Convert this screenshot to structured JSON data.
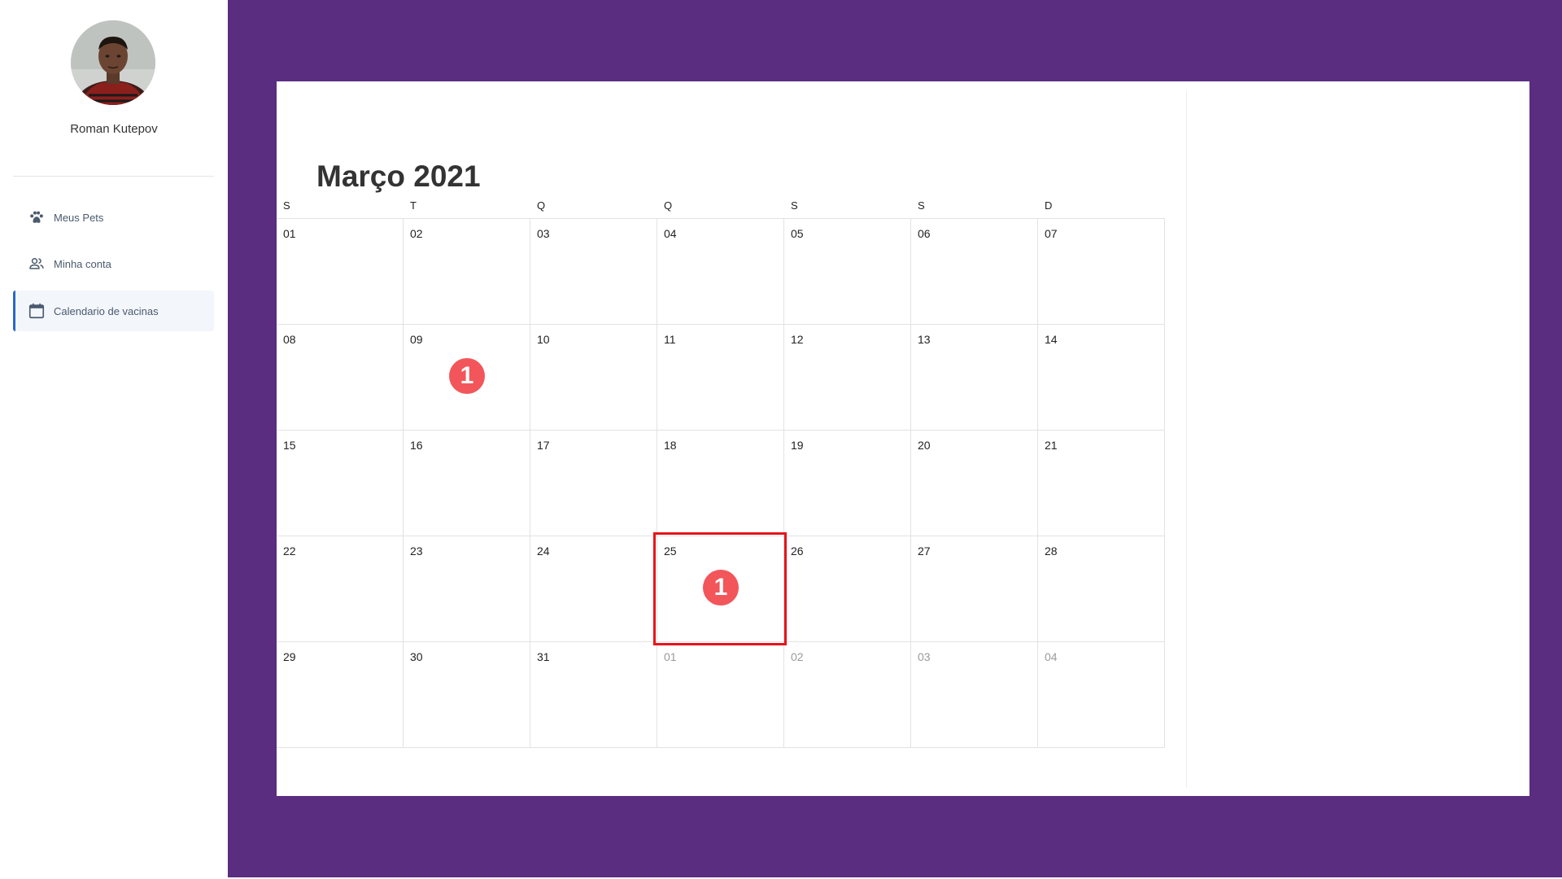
{
  "user": {
    "name": "Roman Kutepov"
  },
  "sidebar": {
    "items": [
      {
        "label": "Meus Pets",
        "icon": "paw-icon"
      },
      {
        "label": "Minha conta",
        "icon": "people-icon"
      },
      {
        "label": "Calendario de vacinas",
        "icon": "calendar-icon",
        "active": true
      }
    ]
  },
  "calendar": {
    "title": "Março 2021",
    "weekdays": [
      "S",
      "T",
      "Q",
      "Q",
      "S",
      "S",
      "D"
    ],
    "weeks": [
      [
        "01",
        "02",
        "03",
        "04",
        "05",
        "06",
        "07"
      ],
      [
        "08",
        "09",
        "10",
        "11",
        "12",
        "13",
        "14"
      ],
      [
        "15",
        "16",
        "17",
        "18",
        "19",
        "20",
        "21"
      ],
      [
        "22",
        "23",
        "24",
        "25",
        "26",
        "27",
        "28"
      ],
      [
        "29",
        "30",
        "31",
        "01",
        "02",
        "03",
        "04"
      ]
    ],
    "outside_days": [
      [
        4,
        3
      ],
      [
        4,
        4
      ],
      [
        4,
        5
      ],
      [
        4,
        6
      ]
    ],
    "badges": [
      {
        "week": 1,
        "day": 1,
        "count": "1"
      },
      {
        "week": 3,
        "day": 3,
        "count": "1"
      }
    ],
    "highlighted": {
      "week": 3,
      "day": 3
    }
  },
  "colors": {
    "main_bg": "#5a2d80",
    "badge": "#f2565a",
    "highlight": "#e8131a",
    "active_accent": "#2a66c9"
  }
}
